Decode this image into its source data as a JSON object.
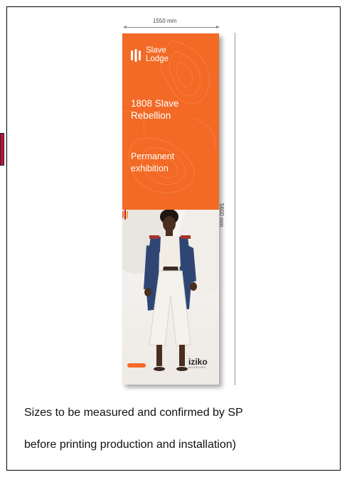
{
  "dimensions": {
    "width_label": "1550 mm",
    "height_label": "5600 mm"
  },
  "banner": {
    "brand_line1": "Slave",
    "brand_line2": "Lodge",
    "title_line1": "1808 Slave",
    "title_line2": "Rebellion",
    "subtitle_line1": "Permanent",
    "subtitle_line2": "exhibition",
    "footer_logo": "iziko",
    "footer_logo_sub": "MUSEUMS",
    "accent_color": "#f26a25"
  },
  "caption": {
    "line1": "Sizes to be measured and confirmed by SP",
    "line2": "before printing production and installation)"
  }
}
